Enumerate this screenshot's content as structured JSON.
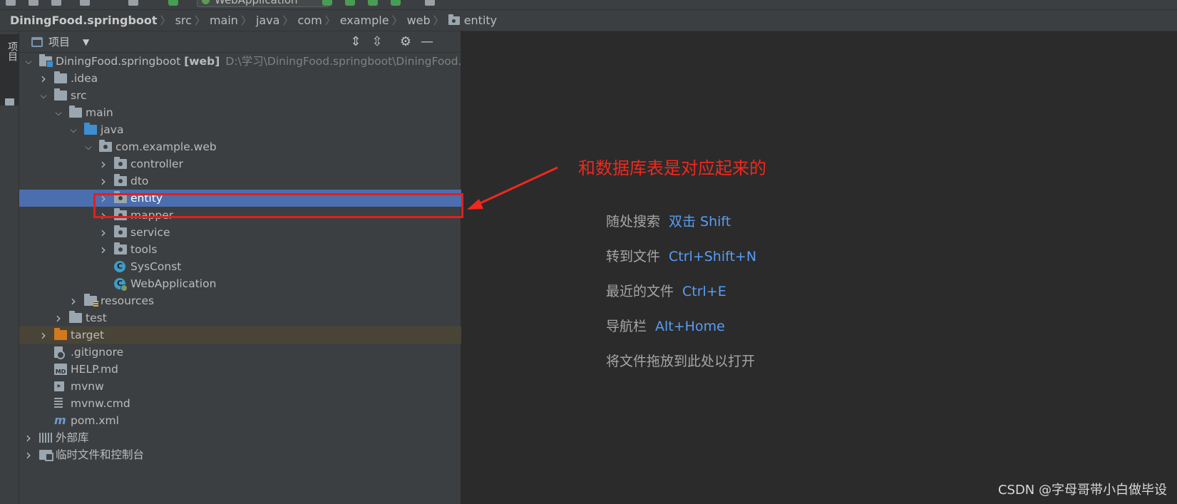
{
  "toolbar": {
    "run_config": "WebApplication"
  },
  "breadcrumb": [
    {
      "label": "DiningFood.springboot",
      "root": true
    },
    {
      "label": "src"
    },
    {
      "label": "main"
    },
    {
      "label": "java"
    },
    {
      "label": "com"
    },
    {
      "label": "example"
    },
    {
      "label": "web"
    },
    {
      "label": "entity",
      "icon": "package-folder-icon"
    }
  ],
  "strip": {
    "label": "项目"
  },
  "panel": {
    "title": "项目"
  },
  "tree": {
    "root_name": "DiningFood.springboot",
    "root_module": "[web]",
    "root_path": "D:\\学习\\DiningFood.springboot\\DiningFood.sp",
    "items": [
      {
        "label": ".idea"
      },
      {
        "label": "src"
      },
      {
        "label": "main"
      },
      {
        "label": "java"
      },
      {
        "label": "com.example.web"
      },
      {
        "label": "controller"
      },
      {
        "label": "dto"
      },
      {
        "label": "entity"
      },
      {
        "label": "mapper"
      },
      {
        "label": "service"
      },
      {
        "label": "tools"
      },
      {
        "label": "SysConst"
      },
      {
        "label": "WebApplication"
      },
      {
        "label": "resources"
      },
      {
        "label": "test"
      },
      {
        "label": "target"
      },
      {
        "label": ".gitignore"
      },
      {
        "label": "HELP.md"
      },
      {
        "label": "mvnw"
      },
      {
        "label": "mvnw.cmd"
      },
      {
        "label": "pom.xml"
      },
      {
        "label": "外部库"
      },
      {
        "label": "临时文件和控制台"
      }
    ]
  },
  "annotation": {
    "text": "和数据库表是对应起来的",
    "color": "#f0281e"
  },
  "editor_hints": [
    {
      "label": "随处搜索",
      "key": "双击 Shift"
    },
    {
      "label": "转到文件",
      "key": "Ctrl+Shift+N"
    },
    {
      "label": "最近的文件",
      "key": "Ctrl+E"
    },
    {
      "label": "导航栏",
      "key": "Alt+Home"
    },
    {
      "label": "将文件拖放到此处以打开",
      "key": ""
    }
  ],
  "watermark": "CSDN @字母哥带小白做毕设",
  "colors": {
    "selection": "#4b6eaf",
    "key_hint": "#589df6",
    "highlight_box": "#e02020"
  }
}
